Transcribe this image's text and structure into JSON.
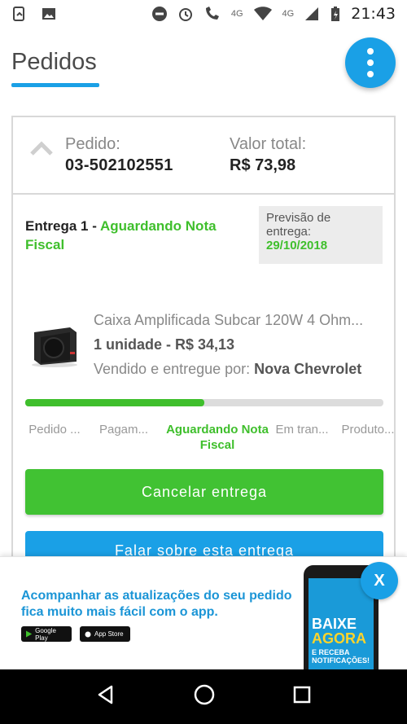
{
  "status_bar": {
    "network": "4G",
    "network2": "4G",
    "time": "21:43"
  },
  "header": {
    "title": "Pedidos"
  },
  "order": {
    "order_label": "Pedido:",
    "order_number": "03-502102551",
    "total_label": "Valor total:",
    "total_value": "R$ 73,98"
  },
  "delivery": {
    "title_prefix": "Entrega 1 - ",
    "status": "Aguardando Nota Fiscal",
    "forecast_label": "Previsão de entrega:",
    "forecast_date": "29/10/2018"
  },
  "product": {
    "name": "Caixa Amplificada Subcar 120W 4 Ohm...",
    "quantity_price": "1 unidade - R$ 34,13",
    "seller_prefix": "Vendido e entregue por: ",
    "seller_name": "Nova Chevrolet"
  },
  "progress": {
    "fraction": 0.5
  },
  "steps": [
    {
      "label": "Pedido ..."
    },
    {
      "label": "Pagam..."
    },
    {
      "label": "Aguardando Nota Fiscal"
    },
    {
      "label": "Em tran..."
    },
    {
      "label": "Produto..."
    }
  ],
  "actions": {
    "cancel_label": "Cancelar entrega",
    "talk_label": "Falar sobre esta entrega"
  },
  "banner": {
    "text": "Acompanhar as atualizações do seu pedido fica muito mais fácil com o app.",
    "google_play": "Google Play",
    "app_store": "App Store",
    "phone_line1": "BAIXE",
    "phone_line2": "AGORA",
    "phone_line3": "E RECEBA NOTIFICAÇÕES!",
    "close_label": "X"
  },
  "colors": {
    "accent_blue": "#1aa0e6",
    "accent_green": "#3fbf2c"
  }
}
